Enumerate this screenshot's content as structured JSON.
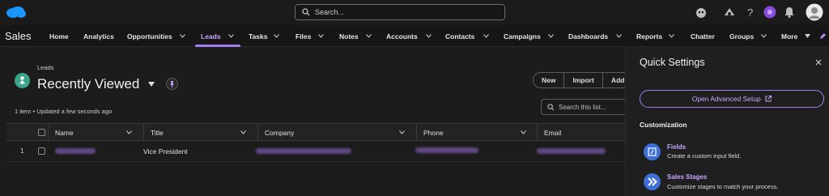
{
  "topbar": {
    "search_placeholder": "Search...",
    "tools": [
      "astro-icon",
      "setup-assistant-icon",
      "help-icon",
      "einstein-icon",
      "notifications-icon",
      "user-avatar"
    ]
  },
  "navbar": {
    "app_name": "Sales",
    "items": [
      {
        "label": "Home"
      },
      {
        "label": "Analytics"
      },
      {
        "label": "Opportunities"
      },
      {
        "label": "Leads",
        "active": true
      },
      {
        "label": "Tasks"
      },
      {
        "label": "Files"
      },
      {
        "label": "Notes"
      },
      {
        "label": "Accounts"
      },
      {
        "label": "Contacts"
      },
      {
        "label": "Campaigns"
      },
      {
        "label": "Dashboards"
      },
      {
        "label": "Reports"
      },
      {
        "label": "Chatter"
      },
      {
        "label": "Groups"
      },
      {
        "label": "More"
      }
    ]
  },
  "list_view": {
    "object_label": "Leads",
    "view_name": "Recently Viewed",
    "status": "1 item • Updated a few seconds ago",
    "buttons": [
      "New",
      "Import",
      "Add"
    ],
    "search_placeholder": "Search this list...",
    "columns": [
      "Name",
      "Title",
      "Company",
      "Phone",
      "Email"
    ],
    "rows": [
      {
        "index": "1",
        "title": "Vice President"
      }
    ]
  },
  "quick_settings": {
    "title": "Quick Settings",
    "open_setup_label": "Open Advanced Setup",
    "section_title": "Customization",
    "features": [
      {
        "title": "Fields",
        "description": "Create a custom input field."
      },
      {
        "title": "Sales Stages",
        "description": "Customize stages to match your process."
      }
    ]
  },
  "colors": {
    "accent": "#a47cf3",
    "brand_cloud": "#1b96ff",
    "leads_icon": "#3ba58c",
    "feature_icon": "#3d6fd6"
  }
}
